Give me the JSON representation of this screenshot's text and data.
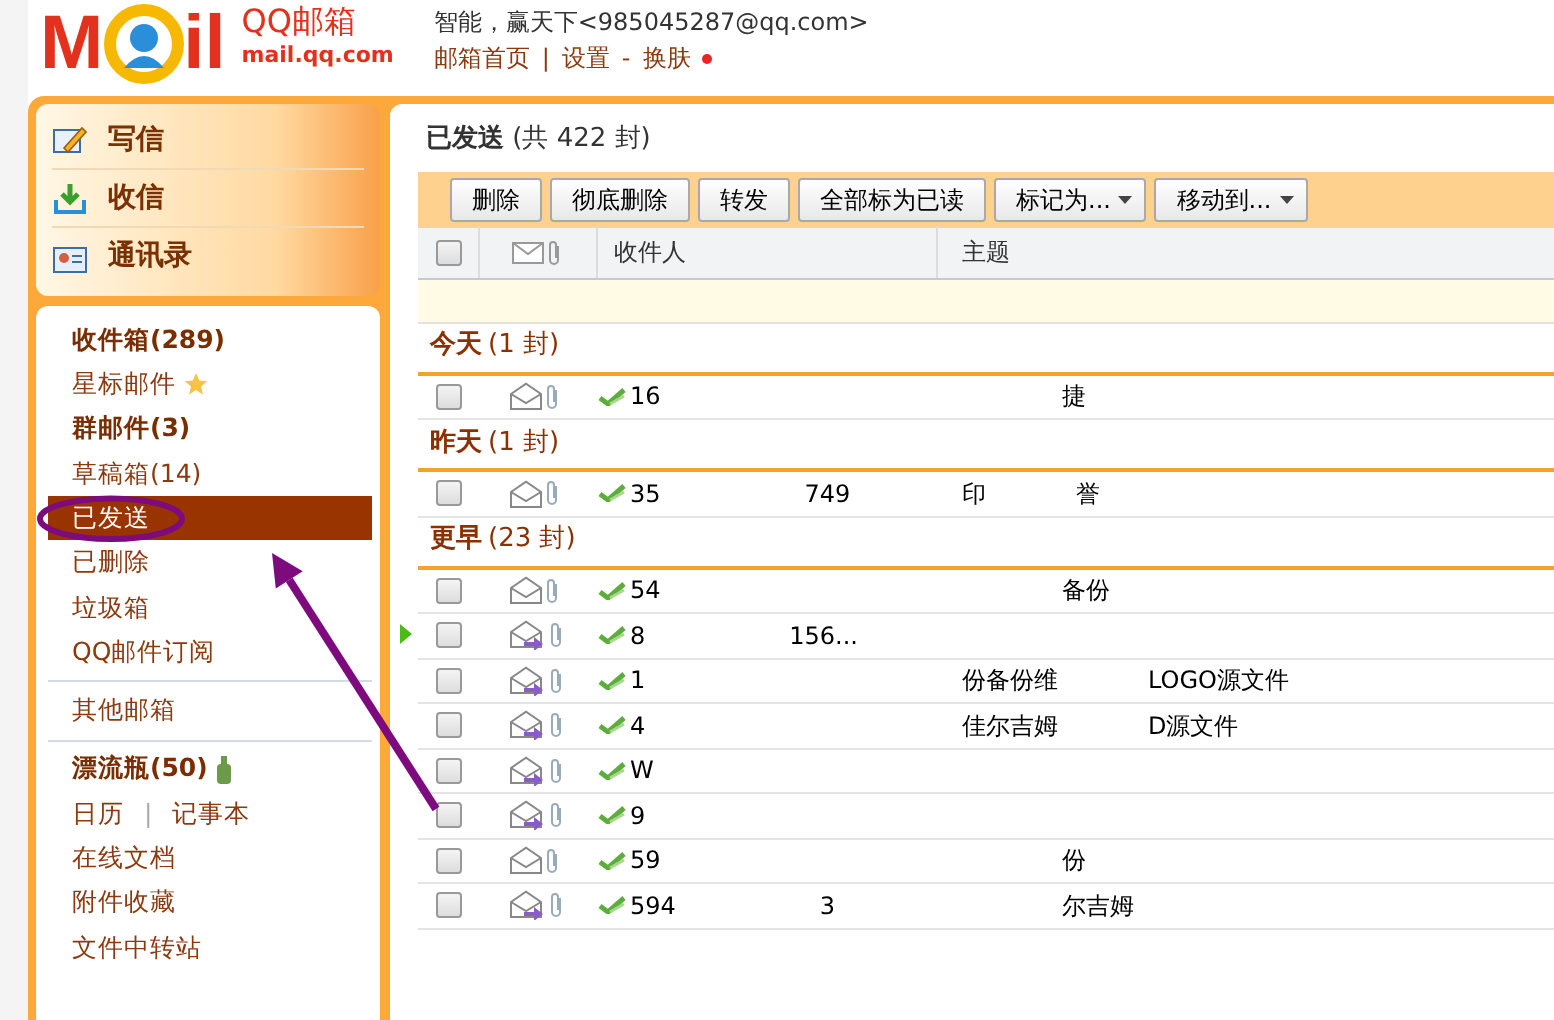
{
  "header": {
    "logo_left": "M",
    "logo_right": "il",
    "brand": "QQ邮箱",
    "domain": "mail.qq.com",
    "account": "智能，赢天下<985045287@qq.com>",
    "links": [
      "邮箱首页",
      "设置",
      "换肤"
    ],
    "link_separators": [
      "|",
      "-"
    ]
  },
  "quick_actions": [
    {
      "label": "写信",
      "kind": "compose"
    },
    {
      "label": "收信",
      "kind": "receive"
    },
    {
      "label": "通讯录",
      "kind": "contacts"
    }
  ],
  "folders": [
    {
      "kind": "folder",
      "label": "收件箱(289)",
      "bold": true,
      "selected": false
    },
    {
      "kind": "starred",
      "label": "星标邮件",
      "bold": false,
      "selected": false
    },
    {
      "kind": "folder",
      "label": "群邮件(3)",
      "bold": true,
      "selected": false
    },
    {
      "kind": "folder",
      "label": "草稿箱(14)",
      "bold": false,
      "selected": false
    },
    {
      "kind": "folder",
      "label": "已发送",
      "bold": false,
      "selected": true
    },
    {
      "kind": "folder",
      "label": "已删除",
      "bold": false,
      "selected": false
    },
    {
      "kind": "folder",
      "label": "垃圾箱",
      "bold": false,
      "selected": false
    },
    {
      "kind": "folder",
      "label": "QQ邮件订阅",
      "bold": false,
      "selected": false
    },
    {
      "kind": "divider"
    },
    {
      "kind": "folder",
      "label": "其他邮箱",
      "bold": false,
      "selected": false
    },
    {
      "kind": "divider"
    },
    {
      "kind": "bottle",
      "label": "漂流瓶(50)",
      "bold": true,
      "selected": false
    },
    {
      "kind": "pair",
      "labels": [
        "日历",
        "记事本"
      ],
      "separator": "|"
    },
    {
      "kind": "folder",
      "label": "在线文档",
      "bold": false,
      "selected": false
    },
    {
      "kind": "folder",
      "label": "附件收藏",
      "bold": false,
      "selected": false
    },
    {
      "kind": "folder",
      "label": "文件中转站",
      "bold": false,
      "selected": false
    }
  ],
  "list": {
    "title": "已发送",
    "count": "(共 422 封)",
    "toolbar": [
      {
        "label": "删除",
        "dropdown": false
      },
      {
        "label": "彻底删除",
        "dropdown": false
      },
      {
        "label": "转发",
        "dropdown": false
      },
      {
        "label": "全部标为已读",
        "dropdown": false
      },
      {
        "label": "标记为...",
        "dropdown": true
      },
      {
        "label": "移动到...",
        "dropdown": true
      }
    ],
    "select_all_checked": false,
    "columns": [
      "收件人",
      "主题"
    ],
    "groups": [
      {
        "label": "今天",
        "count": "(1 封)",
        "rows": [
          {
            "checked": false,
            "current": false,
            "kind": "read",
            "recipient": [
              "16"
            ],
            "subject": [
              "捷"
            ]
          }
        ]
      },
      {
        "label": "昨天",
        "count": "(1 封)",
        "rows": [
          {
            "checked": false,
            "current": false,
            "kind": "read",
            "recipient": [
              "35",
              "749"
            ],
            "subject": [
              "印",
              "誉"
            ]
          }
        ]
      },
      {
        "label": "更早",
        "count": "(23 封)",
        "rows": [
          {
            "checked": false,
            "current": false,
            "kind": "read",
            "recipient": [
              "54"
            ],
            "subject": [
              "备份"
            ]
          },
          {
            "checked": false,
            "current": true,
            "kind": "forwarded",
            "recipient": [
              "8",
              "156..."
            ],
            "subject": []
          },
          {
            "checked": false,
            "current": false,
            "kind": "forwarded",
            "recipient": [
              "1"
            ],
            "subject": [
              "份备份维",
              "LOGO源文件"
            ]
          },
          {
            "checked": false,
            "current": false,
            "kind": "forwarded",
            "recipient": [
              "4"
            ],
            "subject": [
              "佳尔吉姆",
              "D源文件"
            ]
          },
          {
            "checked": false,
            "current": false,
            "kind": "forwarded",
            "recipient": [
              "W"
            ],
            "subject": []
          },
          {
            "checked": false,
            "current": false,
            "kind": "forwarded",
            "recipient": [
              "9"
            ],
            "subject": []
          },
          {
            "checked": false,
            "current": false,
            "kind": "read",
            "recipient": [
              "59"
            ],
            "subject": [
              "份"
            ]
          },
          {
            "checked": false,
            "current": false,
            "kind": "forwarded",
            "recipient": [
              "594",
              "3"
            ],
            "subject": [
              "尔吉姆"
            ]
          }
        ]
      }
    ]
  }
}
